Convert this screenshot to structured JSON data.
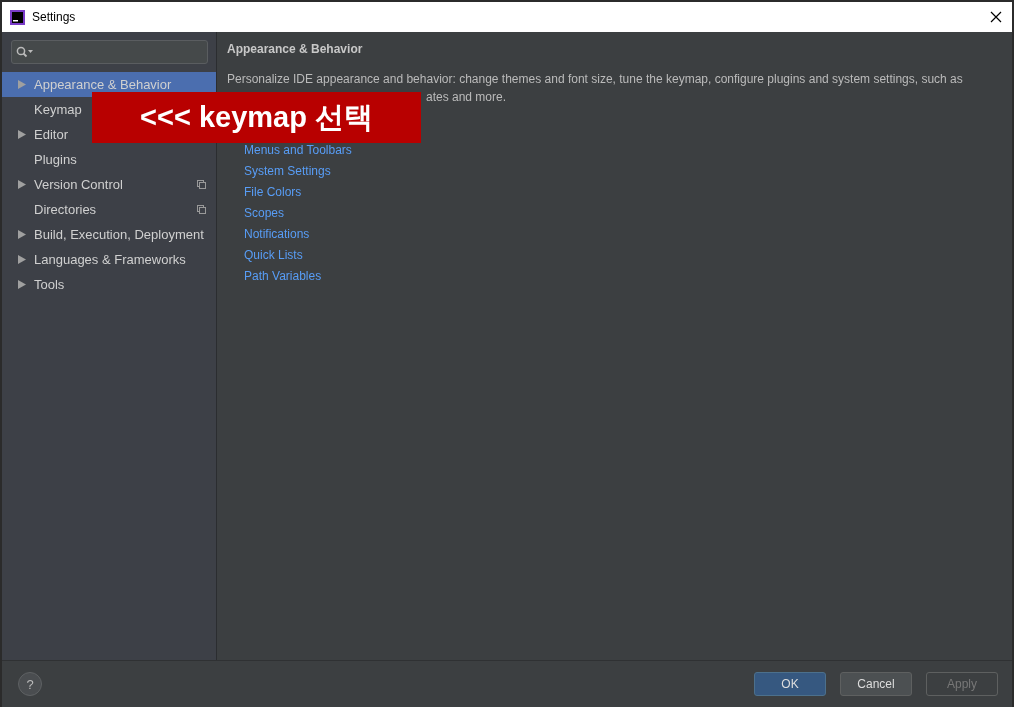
{
  "window": {
    "title": "Settings"
  },
  "sidebar": {
    "items": [
      {
        "label": "Appearance & Behavior",
        "expandable": true,
        "selected": true,
        "project_level": false
      },
      {
        "label": "Keymap",
        "expandable": false,
        "selected": false
      },
      {
        "label": "Editor",
        "expandable": true,
        "selected": false,
        "project_level": false
      },
      {
        "label": "Plugins",
        "expandable": false,
        "selected": false,
        "project_level": false
      },
      {
        "label": "Version Control",
        "expandable": true,
        "selected": false,
        "project_level": true
      },
      {
        "label": "Directories",
        "expandable": false,
        "selected": false,
        "project_level": true
      },
      {
        "label": "Build, Execution, Deployment",
        "expandable": true,
        "selected": false,
        "project_level": false
      },
      {
        "label": "Languages & Frameworks",
        "expandable": true,
        "selected": false,
        "project_level": false
      },
      {
        "label": "Tools",
        "expandable": true,
        "selected": false,
        "project_level": false
      }
    ]
  },
  "content": {
    "title": "Appearance & Behavior",
    "description": [
      "Personalize IDE appearance and behavior: change themes and font size, tune the keymap, configure plugins and system settings, such as",
      "ates and more."
    ],
    "links": [
      "Menus and Toolbars",
      "System Settings",
      "File Colors",
      "Scopes",
      "Notifications",
      "Quick Lists",
      "Path Variables"
    ]
  },
  "banner": {
    "text": "<<< keymap 선택"
  },
  "buttons": [
    {
      "label": "OK",
      "kind": "primary",
      "disabled": false
    },
    {
      "label": "Cancel",
      "kind": "normal",
      "disabled": false
    },
    {
      "label": "Apply",
      "kind": "normal",
      "disabled": true
    }
  ],
  "help": {
    "label": "?"
  }
}
